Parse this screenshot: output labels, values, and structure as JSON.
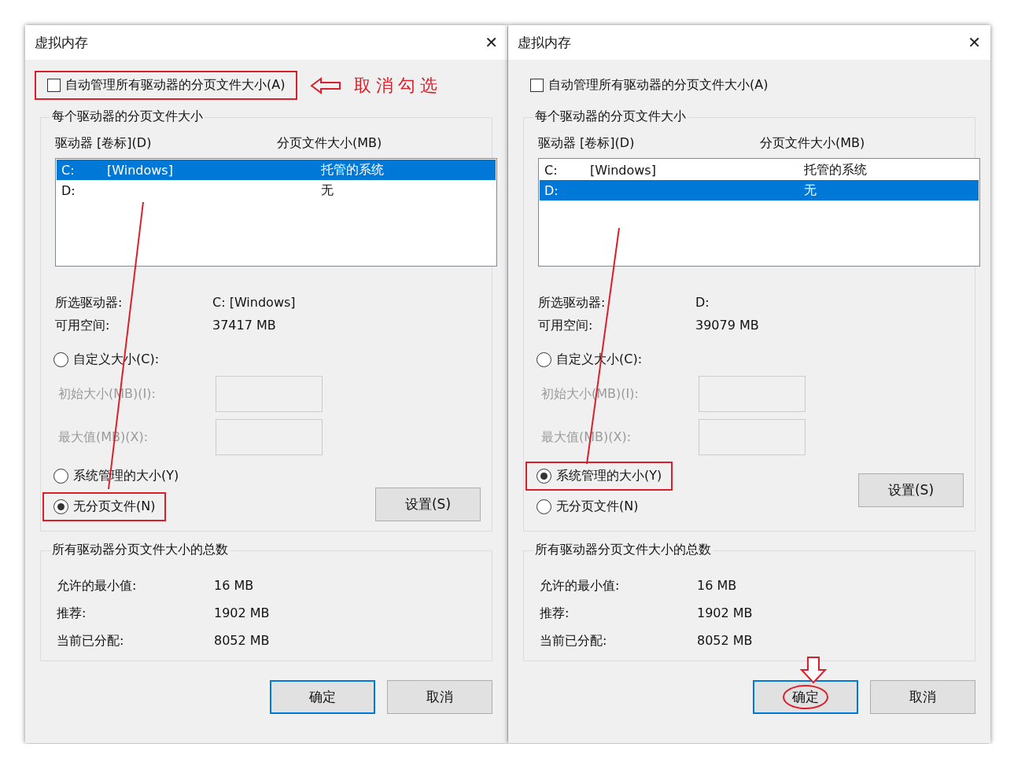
{
  "dialogs": [
    {
      "title": "虚拟内存",
      "close": "✕",
      "auto_manage": {
        "label": "自动管理所有驱动器的分页文件大小(A)",
        "checked": false,
        "highlighted": true
      },
      "note": "取消勾选",
      "group_title": "每个驱动器的分页文件大小",
      "columns": [
        "驱动器 [卷标](D)",
        "分页文件大小(MB)"
      ],
      "drives": [
        {
          "letter": "C:",
          "label": "[Windows]",
          "size": "托管的系统",
          "selected": true
        },
        {
          "letter": "D:",
          "size": "无",
          "selected": false
        }
      ],
      "selected_drive_label": "所选驱动器:",
      "selected_drive": "C:  [Windows]",
      "free_label": "可用空间:",
      "free": "37417 MB",
      "custom": {
        "label": "自定义大小(C):",
        "selected": false,
        "highlighted": false
      },
      "fields": [
        {
          "label": "初始大小(MB)(I):",
          "disabled": true
        },
        {
          "label": "最大值(MB)(X):",
          "disabled": true
        }
      ],
      "options": [
        {
          "label": "系统管理的大小(Y)",
          "selected": false,
          "highlighted": false
        },
        {
          "label": "无分页文件(N)",
          "selected": true,
          "highlighted": true
        }
      ],
      "set_button": "设置(S)",
      "pointer_line": true,
      "totals": {
        "title": "所有驱动器分页文件大小的总数",
        "rows": [
          {
            "label": "允许的最小值:",
            "value": "16 MB"
          },
          {
            "label": "推荐:",
            "value": "1902 MB"
          },
          {
            "label": "当前已分配:",
            "value": "8052 MB"
          }
        ]
      },
      "buttons": [
        {
          "label": "确定",
          "default": true,
          "circled": false
        },
        {
          "label": "取消",
          "default": false,
          "circled": false
        }
      ]
    },
    {
      "title": "虚拟内存",
      "close": "✕",
      "auto_manage": {
        "label": "自动管理所有驱动器的分页文件大小(A)",
        "checked": false,
        "highlighted": false
      },
      "group_title": "每个驱动器的分页文件大小",
      "columns": [
        "驱动器 [卷标](D)",
        "分页文件大小(MB)"
      ],
      "drives": [
        {
          "letter": "C:",
          "label": "[Windows]",
          "size": "托管的系统",
          "selected": false
        },
        {
          "letter": "D:",
          "size": "无",
          "selected": true
        }
      ],
      "selected_drive_label": "所选驱动器:",
      "selected_drive": "D:",
      "free_label": "可用空间:",
      "free": "39079 MB",
      "custom": {
        "label": "自定义大小(C):",
        "selected": false,
        "highlighted": false
      },
      "fields": [
        {
          "label": "初始大小(MB)(I):",
          "disabled": true
        },
        {
          "label": "最大值(MB)(X):",
          "disabled": true
        }
      ],
      "options": [
        {
          "label": "系统管理的大小(Y)",
          "selected": true,
          "highlighted": true
        },
        {
          "label": "无分页文件(N)",
          "selected": false,
          "highlighted": false
        }
      ],
      "set_button": "设置(S)",
      "pointer_line": true,
      "totals": {
        "title": "所有驱动器分页文件大小的总数",
        "rows": [
          {
            "label": "允许的最小值:",
            "value": "16 MB"
          },
          {
            "label": "推荐:",
            "value": "1902 MB"
          },
          {
            "label": "当前已分配:",
            "value": "8052 MB"
          }
        ]
      },
      "buttons": [
        {
          "label": "确定",
          "default": true,
          "circled": true
        },
        {
          "label": "取消",
          "default": false,
          "circled": false
        }
      ]
    }
  ]
}
